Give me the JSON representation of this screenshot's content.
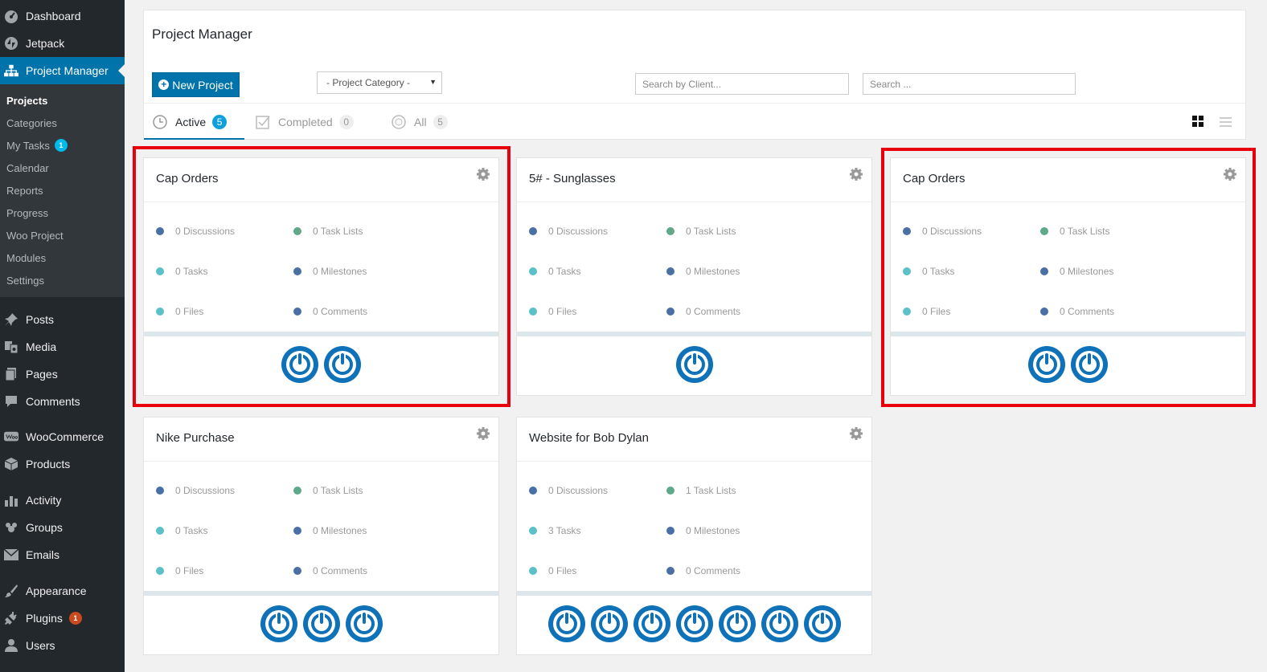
{
  "sidebar": {
    "items": [
      {
        "label": "Dashboard",
        "icon": "dashboard-icon"
      },
      {
        "label": "Jetpack",
        "icon": "jetpack-icon"
      },
      {
        "label": "Project Manager",
        "icon": "sitemap-icon"
      },
      {
        "label": "Posts",
        "icon": "pushpin-icon"
      },
      {
        "label": "Media",
        "icon": "media-icon"
      },
      {
        "label": "Pages",
        "icon": "pages-icon"
      },
      {
        "label": "Comments",
        "icon": "comment-icon"
      },
      {
        "label": "WooCommerce",
        "icon": "woocommerce-icon"
      },
      {
        "label": "Products",
        "icon": "box-icon"
      },
      {
        "label": "Activity",
        "icon": "activity-icon"
      },
      {
        "label": "Groups",
        "icon": "groups-icon"
      },
      {
        "label": "Emails",
        "icon": "envelope-icon"
      },
      {
        "label": "Appearance",
        "icon": "brush-icon"
      },
      {
        "label": "Plugins",
        "icon": "plug-icon",
        "badge": "1"
      },
      {
        "label": "Users",
        "icon": "user-icon"
      }
    ],
    "submenu": [
      {
        "label": "Projects"
      },
      {
        "label": "Categories"
      },
      {
        "label": "My Tasks",
        "badge": "1"
      },
      {
        "label": "Calendar"
      },
      {
        "label": "Reports"
      },
      {
        "label": "Progress"
      },
      {
        "label": "Woo Project"
      },
      {
        "label": "Modules"
      },
      {
        "label": "Settings"
      }
    ]
  },
  "header": {
    "title": "Project Manager",
    "new_project_label": "New Project",
    "category_select": "- Project Category -",
    "search_client_placeholder": "Search by Client...",
    "search_placeholder": "Search ..."
  },
  "tabs": [
    {
      "label": "Active",
      "count": "5"
    },
    {
      "label": "Completed",
      "count": "0"
    },
    {
      "label": "All",
      "count": "5"
    }
  ],
  "projects": [
    {
      "title": "Cap Orders",
      "discussions": "0 Discussions",
      "task_lists": "0 Task Lists",
      "tasks": "0 Tasks",
      "milestones": "0 Milestones",
      "files": "0 Files",
      "comments": "0 Comments",
      "avatars": 2
    },
    {
      "title": "5# - Sunglasses",
      "discussions": "0 Discussions",
      "task_lists": "0 Task Lists",
      "tasks": "0 Tasks",
      "milestones": "0 Milestones",
      "files": "0 Files",
      "comments": "0 Comments",
      "avatars": 1
    },
    {
      "title": "Cap Orders",
      "discussions": "0 Discussions",
      "task_lists": "0 Task Lists",
      "tasks": "0 Tasks",
      "milestones": "0 Milestones",
      "files": "0 Files",
      "comments": "0 Comments",
      "avatars": 2
    },
    {
      "title": "Nike Purchase",
      "discussions": "0 Discussions",
      "task_lists": "0 Task Lists",
      "tasks": "0 Tasks",
      "milestones": "0 Milestones",
      "files": "0 Files",
      "comments": "0 Comments",
      "avatars": 3
    },
    {
      "title": "Website for Bob Dylan",
      "discussions": "0 Discussions",
      "task_lists": "1 Task Lists",
      "tasks": "3 Tasks",
      "milestones": "0 Milestones",
      "files": "0 Files",
      "comments": "0 Comments",
      "avatars": 7
    }
  ],
  "colors": {
    "accent": "#0073aa",
    "highlight": "#e8000c",
    "dot_discussions": "#4a6fa5",
    "dot_task_lists": "#5fa88a",
    "dot_tasks": "#5bc0c8",
    "dot_milestones": "#4a6fa5",
    "dot_files": "#5bc0c8",
    "dot_comments": "#4a6fa5"
  }
}
